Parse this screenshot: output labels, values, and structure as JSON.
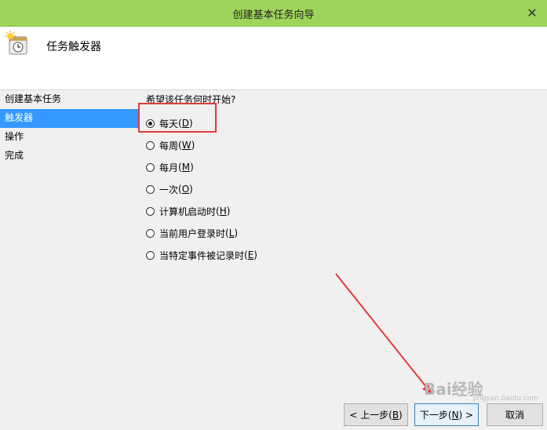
{
  "window": {
    "title": "创建基本任务向导",
    "close_glyph": "✕"
  },
  "header": {
    "title": "任务触发器",
    "icon": "task-clock-icon"
  },
  "sidebar": {
    "steps": [
      {
        "label": "创建基本任务",
        "active": false
      },
      {
        "label": "触发器",
        "active": true
      },
      {
        "label": "操作",
        "active": false
      },
      {
        "label": "完成",
        "active": false
      }
    ]
  },
  "content": {
    "question": "希望该任务何时开始?",
    "options": [
      {
        "label": "每天",
        "mnemonic": "D",
        "checked": true
      },
      {
        "label": "每周",
        "mnemonic": "W",
        "checked": false
      },
      {
        "label": "每月",
        "mnemonic": "M",
        "checked": false
      },
      {
        "label": "一次",
        "mnemonic": "O",
        "checked": false
      },
      {
        "label": "计算机启动时",
        "mnemonic": "H",
        "checked": false
      },
      {
        "label": "当前用户登录时",
        "mnemonic": "L",
        "checked": false
      },
      {
        "label": "当特定事件被记录时",
        "mnemonic": "E",
        "checked": false
      }
    ]
  },
  "buttons": {
    "back": {
      "prefix": "< 上一步(",
      "mnemonic": "B",
      "suffix": ")"
    },
    "next": {
      "prefix": "下一步(",
      "mnemonic": "N",
      "suffix": ") >"
    },
    "cancel": "取消"
  },
  "watermark": {
    "text": "Bai经验",
    "sub": "jingyan.baidu.com"
  },
  "colors": {
    "titlebar": "#9ed45a",
    "selection": "#3399ff",
    "annotation_red": "#e23a3a"
  }
}
